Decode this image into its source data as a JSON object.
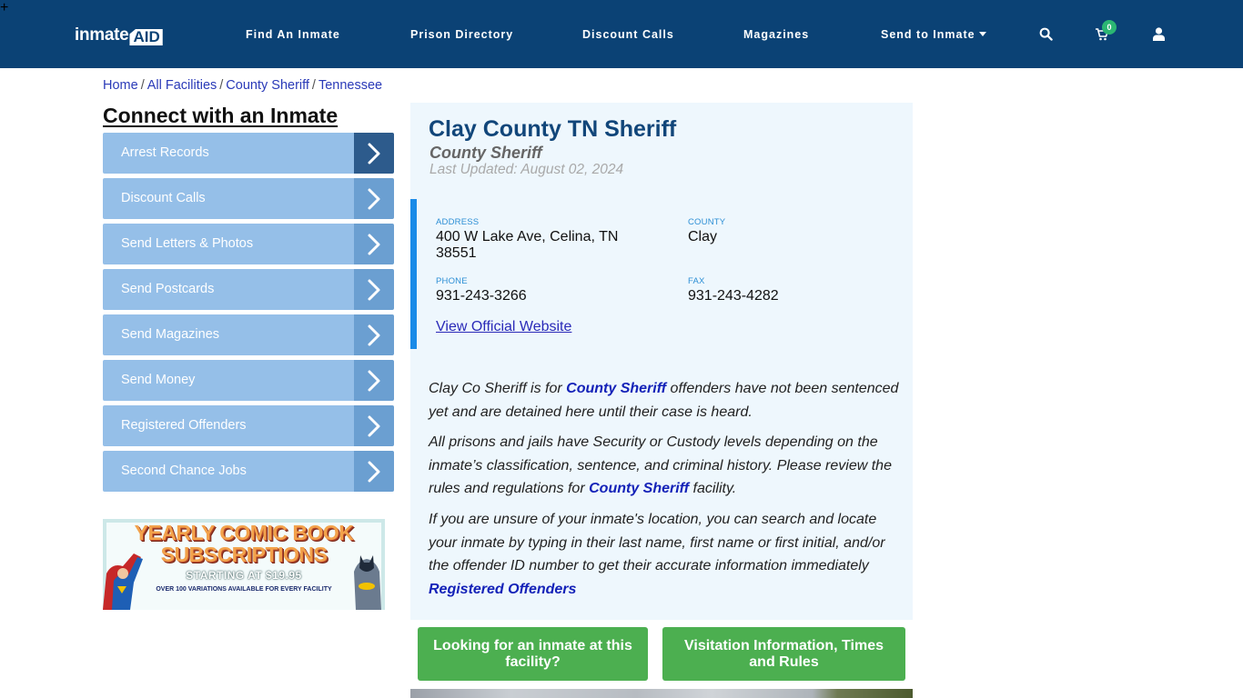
{
  "header": {
    "logo": {
      "text_main": "inmate",
      "text_accent": "AID",
      "plus": "+"
    },
    "nav": [
      {
        "label": "Find An Inmate"
      },
      {
        "label": "Prison Directory"
      },
      {
        "label": "Discount Calls"
      },
      {
        "label": "Magazines"
      },
      {
        "label": "Send to Inmate",
        "has_dropdown": true
      }
    ],
    "icons": {
      "search": "search-icon",
      "cart": "cart-icon",
      "user": "user-icon"
    },
    "cart_count": "0",
    "colors": {
      "bar": "#0b4275",
      "badge": "#2bb673"
    }
  },
  "breadcrumb": {
    "items": [
      "Home",
      "All Facilities",
      "County Sheriff",
      "Tennessee"
    ],
    "separator": "/"
  },
  "sidebar": {
    "title": "Connect with an Inmate",
    "items": [
      {
        "label": "Arrest Records",
        "active": true
      },
      {
        "label": "Discount Calls"
      },
      {
        "label": "Send Letters & Photos"
      },
      {
        "label": "Send Postcards"
      },
      {
        "label": "Send Magazines"
      },
      {
        "label": "Send Money"
      },
      {
        "label": "Registered Offenders"
      },
      {
        "label": "Second Chance Jobs"
      }
    ],
    "banner": {
      "line1": "YEARLY COMIC BOOK",
      "line2": "SUBSCRIPTIONS",
      "line3": "STARTING AT $19.95",
      "line4": "OVER 100 VARIATIONS AVAILABLE FOR EVERY FACILITY"
    }
  },
  "facility": {
    "title": "Clay County TN Sheriff",
    "type": "County Sheriff",
    "last_updated": "Last Updated: August 02, 2024",
    "address_label": "ADDRESS",
    "address_line1": "400 W Lake Ave, Celina, TN",
    "address_line2": "38551",
    "county_label": "COUNTY",
    "county": "Clay",
    "phone_label": "PHONE",
    "phone": "931-243-3266",
    "fax_label": "FAX",
    "fax": "931-243-4282",
    "website_link": "View Official Website",
    "accent_color": "#1a8be8"
  },
  "description": {
    "p1_a": "Clay Co Sheriff is for ",
    "p1_link": "County Sheriff",
    "p1_b": " offenders have not been sentenced yet and are detained here until their case is heard.",
    "p2_a": "All prisons and jails have Security or Custody levels depending on the inmate’s classification, sentence, and criminal history. Please review the rules and regulations for ",
    "p2_link": "County Sheriff",
    "p2_b": " facility.",
    "p3": "If you are unsure of your inmate's location, you can search and locate your inmate by typing in their last name, first name or first initial, and/or the offender ID number to get their accurate information immediately",
    "p3_link": "Registered Offenders"
  },
  "actions": {
    "find_inmate": "Looking for an inmate at this facility?",
    "visitation": "Visitation Information, Times and Rules",
    "color": "#4caf50"
  }
}
